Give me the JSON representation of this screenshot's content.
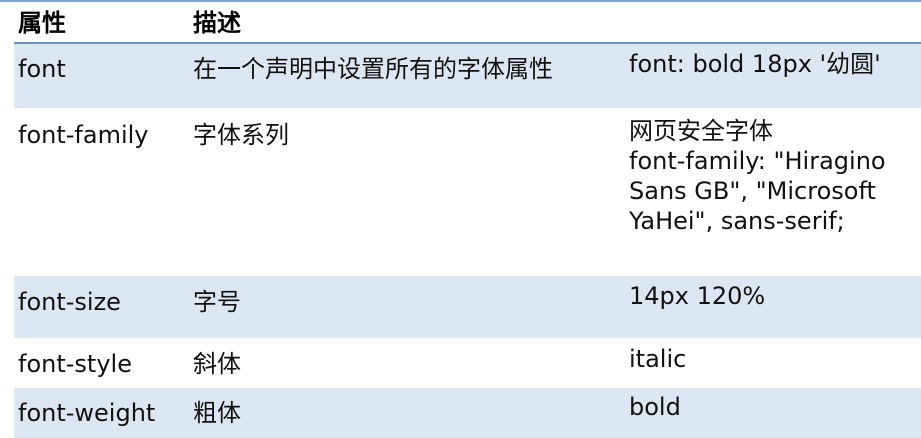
{
  "table": {
    "headers": [
      "属性",
      "描述"
    ],
    "rows": [
      {
        "property": "font",
        "description": "在一个声明中设置所有的字体属性",
        "example": "font: bold 18px '幼圆'"
      },
      {
        "property": "font-family",
        "description": "字体系列",
        "example": "网页安全字体\nfont-family: \"Hiragino\nSans GB\", \"Microsoft\nYaHei\", sans-serif;"
      },
      {
        "property": "font-size",
        "description": "字号",
        "example": "14px  120%"
      },
      {
        "property": "font-style",
        "description": "斜体",
        "example": "italic"
      },
      {
        "property": "font-weight",
        "description": "粗体",
        "example": "bold"
      }
    ]
  },
  "colors": {
    "row_shade": "#dde7f3",
    "rule": "#6f95c7"
  }
}
